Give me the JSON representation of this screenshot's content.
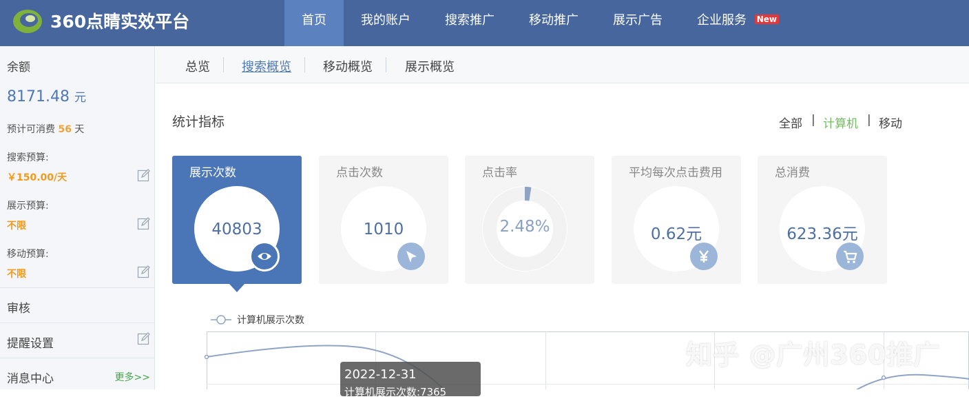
{
  "header": {
    "logo_text": "360点睛实效平台",
    "nav": [
      {
        "label": "首页",
        "active": true
      },
      {
        "label": "我的账户",
        "active": false
      },
      {
        "label": "搜索推广",
        "active": false
      },
      {
        "label": "移动推广",
        "active": false
      },
      {
        "label": "展示广告",
        "active": false
      },
      {
        "label": "企业服务",
        "active": false,
        "badge": "New"
      }
    ]
  },
  "sidebar": {
    "balance_title": "余额",
    "balance_value": "8171.48",
    "balance_unit": "元",
    "estimate_prefix": "预计可消费",
    "estimate_days": "56",
    "estimate_suffix": "天",
    "search_budget_label": "搜索预算:",
    "search_budget_value": "￥150.00/天",
    "display_budget_label": "展示预算:",
    "display_budget_value": "不限",
    "mobile_budget_label": "移动预算:",
    "mobile_budget_value": "不限",
    "audit": "审核",
    "reminder": "提醒设置",
    "messages": "消息中心",
    "more": "更多>>"
  },
  "subnav": {
    "tabs": [
      {
        "label": "总览",
        "active": false
      },
      {
        "label": "搜索概览",
        "active": true
      },
      {
        "label": "移动概览",
        "active": false
      },
      {
        "label": "展示概览",
        "active": false
      }
    ]
  },
  "stats": {
    "title": "统计指标",
    "filters": [
      {
        "label": "全部",
        "active": false
      },
      {
        "label": "计算机",
        "active": true
      },
      {
        "label": "移动",
        "active": false
      }
    ],
    "cards": [
      {
        "label": "展示次数",
        "value": "40803",
        "icon": "eye-icon",
        "active": true
      },
      {
        "label": "点击次数",
        "value": "1010",
        "icon": "cursor-icon",
        "active": false
      },
      {
        "label": "点击率",
        "value": "2.48%",
        "icon": "ring-chart",
        "active": false,
        "ratio": 0.0248
      },
      {
        "label": "平均每次点击费用",
        "value": "0.62元",
        "icon": "yen-icon",
        "active": false
      },
      {
        "label": "总消费",
        "value": "623.36元",
        "icon": "cart-icon",
        "active": false
      }
    ]
  },
  "chart": {
    "legend": "计算机展示次数",
    "tooltip_date": "2022-12-31",
    "tooltip_line": "计算机展示次数:7365"
  },
  "watermark": "知乎 @广州360推广",
  "colors": {
    "nav_bg": "#46669d",
    "nav_active": "#5b82bf",
    "card_active": "#4a76b8",
    "accent_orange": "#f39a1a",
    "accent_green": "#6fbf5d"
  }
}
